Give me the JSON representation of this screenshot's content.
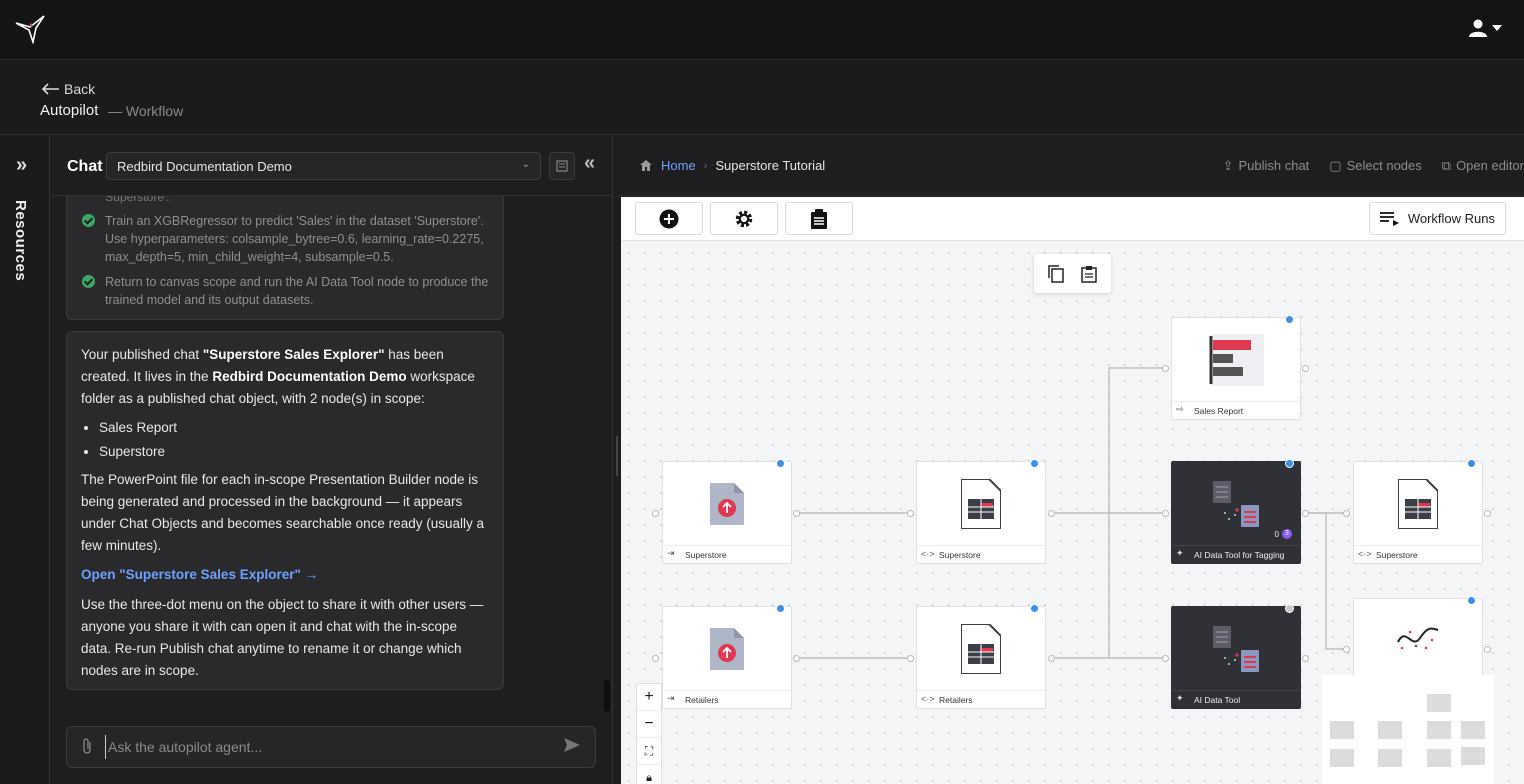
{
  "topbar": {
    "logo": "hummingbird-logo",
    "user_icon": "user-icon"
  },
  "header": {
    "back_label": "Back",
    "title": "Autopilot",
    "subtitle": "— Workflow"
  },
  "resources": {
    "label": "Resources"
  },
  "chat": {
    "title": "Chat",
    "workspace": "Redbird Documentation Demo",
    "fragment": "'Superstore'.",
    "steps": [
      "Train an XGBRegressor to predict 'Sales' in the dataset 'Superstore'. Use hyperparameters: colsample_bytree=0.6, learning_rate=0.2275, max_depth=5, min_child_weight=4, subsample=0.5.",
      "Return to canvas scope and run the AI Data Tool node to produce the trained model and its output datasets."
    ],
    "message": {
      "p1_a": "Your published chat ",
      "p1_b": "\"Superstore Sales Explorer\"",
      "p1_c": " has been created. It lives in the ",
      "p1_d": "Redbird Documentation Demo",
      "p1_e": " workspace folder as a published chat object, with 2 node(s) in scope:",
      "items": [
        "Sales Report",
        "Superstore"
      ],
      "p2": "The PowerPoint file for each in-scope Presentation Builder node is being generated and processed in the background — it appears under Chat Objects and becomes searchable once ready (usually a few minutes).",
      "link": "Open \"Superstore Sales Explorer\" →",
      "p3": "Use the three-dot menu on the object to share it with other users — anyone you share it with can open it and chat with the in-scope data. Re-run Publish chat anytime to rename it or change which nodes are in scope."
    },
    "composer_placeholder": "Ask the autopilot agent..."
  },
  "canvas_header": {
    "home": "Home",
    "current": "Superstore Tutorial",
    "actions": [
      "Publish chat",
      "Select nodes",
      "Open editor"
    ]
  },
  "toolbar": {
    "workflow_runs": "Workflow Runs"
  },
  "nodes": {
    "superstore_upload": "Superstore",
    "superstore_dataset": "Superstore",
    "retailers_upload": "Retailers",
    "retailers_dataset": "Retailers",
    "sales_report": "Sales Report",
    "ai_tagging": "AI Data Tool for Tagging",
    "ai_tool": "AI Data Tool",
    "superstore_out": "Superstore",
    "counter_left": "0",
    "counter_right": "3"
  },
  "colors": {
    "accent": "#6ea1ff",
    "success": "#3aa866",
    "node_dark": "#2f3137",
    "chart_red": "#e0394f"
  }
}
